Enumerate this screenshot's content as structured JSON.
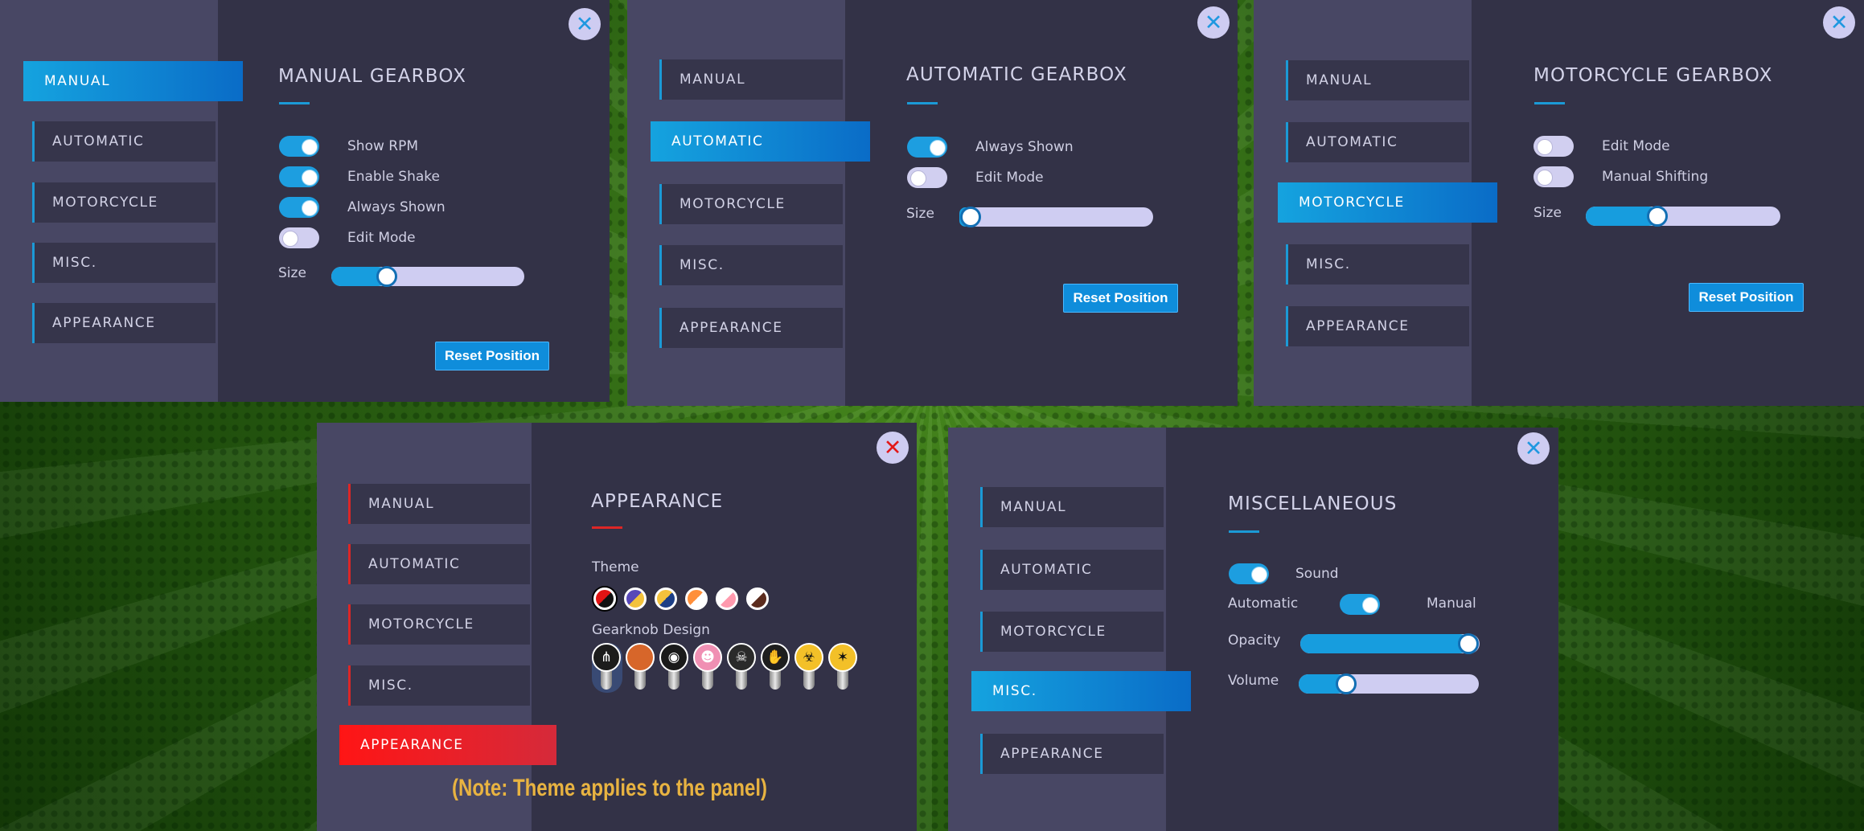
{
  "nav_items": [
    "MANUAL",
    "AUTOMATIC",
    "MOTORCYCLE",
    "MISC.",
    "APPEARANCE"
  ],
  "close_glyph": "✕",
  "size_label": "Size",
  "reset_label": "Reset Position",
  "manual": {
    "title": "MANUAL GEARBOX",
    "active": "MANUAL",
    "toggles": [
      {
        "label": "Show RPM",
        "on": true
      },
      {
        "label": "Enable Shake",
        "on": true
      },
      {
        "label": "Always Shown",
        "on": true
      },
      {
        "label": "Edit Mode",
        "on": false
      }
    ],
    "size_level": 0.26
  },
  "automatic": {
    "title": "AUTOMATIC GEARBOX",
    "active": "AUTOMATIC",
    "toggles": [
      {
        "label": "Always Shown",
        "on": true
      },
      {
        "label": "Edit Mode",
        "on": false
      }
    ],
    "size_level": 0.0
  },
  "motorcycle": {
    "title": "MOTORCYCLE GEARBOX",
    "active": "MOTORCYCLE",
    "toggles": [
      {
        "label": "Edit Mode",
        "on": false
      },
      {
        "label": "Manual Shifting",
        "on": false
      }
    ],
    "size_level": 0.35
  },
  "appearance": {
    "title": "APPEARANCE",
    "active": "APPEARANCE",
    "theme_label": "Theme",
    "gearknob_label": "Gearknob Design",
    "themes": [
      {
        "c1": "#e11414",
        "c2": "#111111",
        "selected": true
      },
      {
        "c1": "#5848b8",
        "c2": "#f3c23c",
        "selected": false
      },
      {
        "c1": "#f3c23c",
        "c2": "#1c3e86",
        "selected": false
      },
      {
        "c1": "#ff8f3a",
        "c2": "#ffffff",
        "selected": false
      },
      {
        "c1": "#ffffff",
        "c2": "#ff9aae",
        "selected": false
      },
      {
        "c1": "#ffffff",
        "c2": "#5b2b1d",
        "selected": false
      }
    ],
    "knobs": [
      {
        "icon": "shift-pattern-icon",
        "glyph": "⋔",
        "bg": "#1c1c1c",
        "selected": true
      },
      {
        "icon": "basketball-icon",
        "glyph": "",
        "bg": "#d7662a",
        "selected": false
      },
      {
        "icon": "eye-icon",
        "glyph": "◉",
        "bg": "#1a1a1a",
        "selected": false
      },
      {
        "icon": "cat-face-icon",
        "glyph": "☻",
        "bg": "#f08fb3",
        "selected": false
      },
      {
        "icon": "skull-icon",
        "glyph": "☠",
        "bg": "#2a2a2a",
        "selected": false
      },
      {
        "icon": "middle-finger-icon",
        "glyph": "✋",
        "bg": "#1e1e1e",
        "selected": false
      },
      {
        "icon": "biohazard-icon",
        "glyph": "☣",
        "bg": "#f3c028",
        "selected": false
      },
      {
        "icon": "bat-icon",
        "glyph": "✶",
        "bg": "#f3c028",
        "selected": false
      }
    ],
    "note": "(Note: Theme applies to the panel)"
  },
  "misc": {
    "title": "MISCELLANEOUS",
    "active": "MISC.",
    "sound_label": "Sound",
    "sound_on": true,
    "automatic_label": "Automatic",
    "manual_label": "Manual",
    "trans_manual": true,
    "opacity_label": "Opacity",
    "opacity_level": 1.0,
    "volume_label": "Volume",
    "volume_level": 0.23
  }
}
